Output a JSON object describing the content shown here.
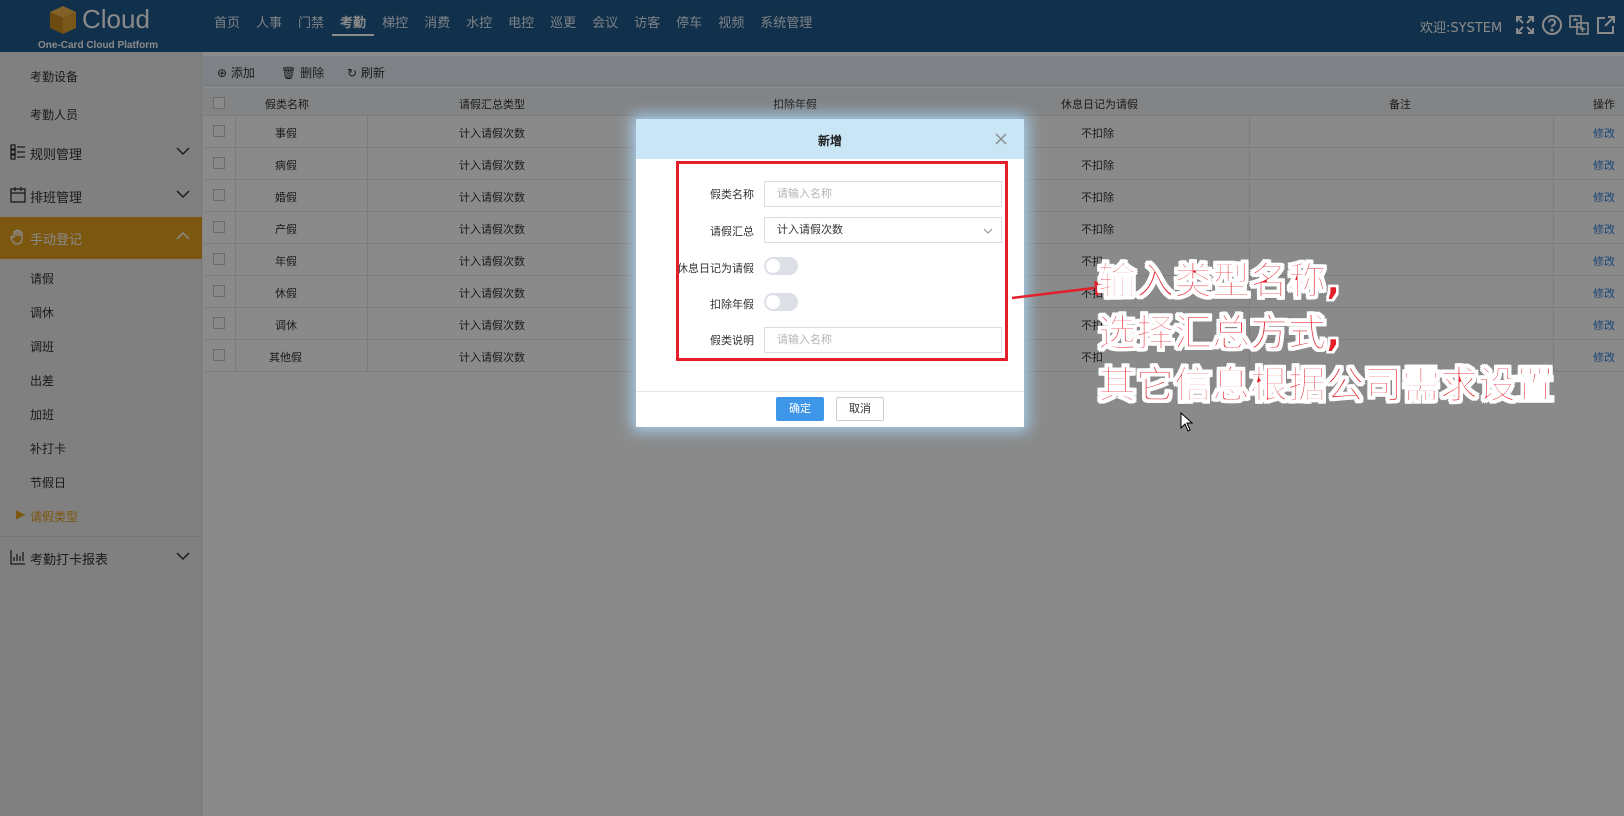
{
  "header": {
    "logo_text": "Cloud",
    "logo_sub": "One-Card Cloud Platform",
    "nav": [
      "首页",
      "人事",
      "门禁",
      "考勤",
      "梯控",
      "消费",
      "水控",
      "电控",
      "巡更",
      "会议",
      "访客",
      "停车",
      "视频",
      "系统管理"
    ],
    "active_nav": "考勤",
    "welcome": "欢迎:SYSTEM",
    "icons": [
      "fullscreen-icon",
      "help-icon",
      "translate-icon",
      "external-link-icon"
    ]
  },
  "sidebar": {
    "top_items": [
      "考勤设备",
      "考勤人员"
    ],
    "groups": [
      {
        "label": "规则管理",
        "icon": "list-icon"
      },
      {
        "label": "排班管理",
        "icon": "calendar-icon"
      },
      {
        "label": "手动登记",
        "icon": "hand-icon"
      }
    ],
    "manual_items": [
      "请假",
      "调休",
      "调班",
      "出差",
      "加班",
      "补打卡",
      "节假日",
      "请假类型"
    ],
    "active_item": "请假类型",
    "report_group": "考勤打卡报表"
  },
  "toolbar": {
    "add": "添加",
    "delete": "删除",
    "refresh": "刷新"
  },
  "table": {
    "headers": [
      "假类名称",
      "请假汇总类型",
      "扣除年假",
      "休息日记为请假",
      "备注",
      "操作"
    ],
    "rows": [
      {
        "name": "事假",
        "summary": "计入请假次数",
        "rest": "不扣除",
        "op": "修改"
      },
      {
        "name": "病假",
        "summary": "计入请假次数",
        "rest": "不扣除",
        "op": "修改"
      },
      {
        "name": "婚假",
        "summary": "计入请假次数",
        "rest": "不扣除",
        "op": "修改"
      },
      {
        "name": "产假",
        "summary": "计入请假次数",
        "rest": "不扣除",
        "op": "修改"
      },
      {
        "name": "年假",
        "summary": "计入请假次数",
        "rest": "不扣",
        "op": "修改"
      },
      {
        "name": "休假",
        "summary": "计入请假次数",
        "rest": "不扣",
        "op": "修改"
      },
      {
        "name": "调休",
        "summary": "计入请假次数",
        "rest": "不扣",
        "op": "修改"
      },
      {
        "name": "其他假",
        "summary": "计入请假次数",
        "rest": "不扣",
        "op": "修改"
      }
    ]
  },
  "dialog": {
    "title": "新增",
    "fields": {
      "name_label": "假类名称",
      "name_placeholder": "请输入名称",
      "summary_label": "请假汇总",
      "summary_value": "计入请假次数",
      "rest_label": "休息日记为请假",
      "rest_on": false,
      "deduct_label": "扣除年假",
      "deduct_on": false,
      "desc_label": "假类说明",
      "desc_placeholder": "请输入名称"
    },
    "ok": "确定",
    "cancel": "取消"
  },
  "annotation": {
    "line1": "输入类型名称,",
    "line2": "选择汇总方式,",
    "line3": "其它信息根据公司需求设置",
    "color": "#e3202a"
  },
  "colors": {
    "header_bg": "#1f5a8c",
    "accent": "#e6a11c",
    "primary_button": "#3e96e8"
  }
}
